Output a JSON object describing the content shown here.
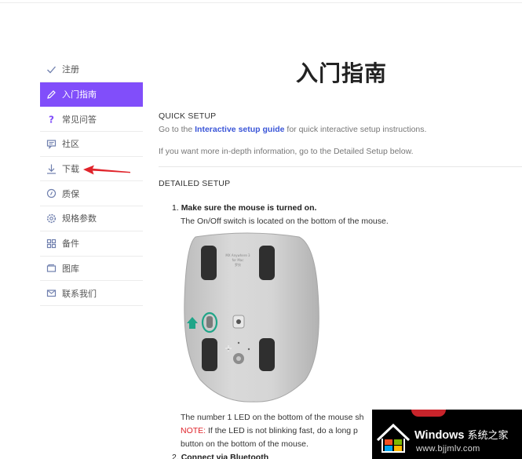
{
  "sidebar": {
    "items": [
      {
        "label": "注册",
        "icon": "check-icon",
        "active": false
      },
      {
        "label": "入门指南",
        "icon": "pencil-icon",
        "active": true
      },
      {
        "label": "常见问答",
        "icon": "question-icon",
        "active": false
      },
      {
        "label": "社区",
        "icon": "chat-icon",
        "active": false
      },
      {
        "label": "下载",
        "icon": "download-icon",
        "active": false
      },
      {
        "label": "质保",
        "icon": "warranty-icon",
        "active": false
      },
      {
        "label": "规格参数",
        "icon": "settings-icon",
        "active": false
      },
      {
        "label": "备件",
        "icon": "grid-icon",
        "active": false
      },
      {
        "label": "图库",
        "icon": "gallery-icon",
        "active": false
      },
      {
        "label": "联系我们",
        "icon": "mail-icon",
        "active": false
      }
    ]
  },
  "main": {
    "title": "入门指南",
    "quick_setup": {
      "heading": "QUICK SETUP",
      "line1_prefix": "Go to the ",
      "line1_link": "Interactive setup guide",
      "line1_suffix": " for quick interactive setup instructions.",
      "line2": "If you want more in-depth information, go to the Detailed Setup below."
    },
    "detailed_setup": {
      "heading": "DETAILED SETUP",
      "step1_num": "1.",
      "step1_title": "Make sure the mouse is turned on.",
      "step1_text": "The On/Off switch is located on the bottom of the mouse.",
      "led_text": "The number 1 LED on the bottom of the mouse sh",
      "note_label": "NOTE:",
      "note_text": " If the LED is not blinking fast, do a long p",
      "note_text2": "button on the bottom of the mouse.",
      "step2_num": "2.",
      "step2_title": "Connect via Bluetooth"
    }
  },
  "watermark": {
    "brand": "Windows",
    "brand_cn": "系统之家",
    "url": "www.bjjmlv.com"
  },
  "colors": {
    "accent": "#814efa",
    "link": "#3b56d8",
    "note": "#e0242b",
    "annotation": "#e0242b"
  }
}
